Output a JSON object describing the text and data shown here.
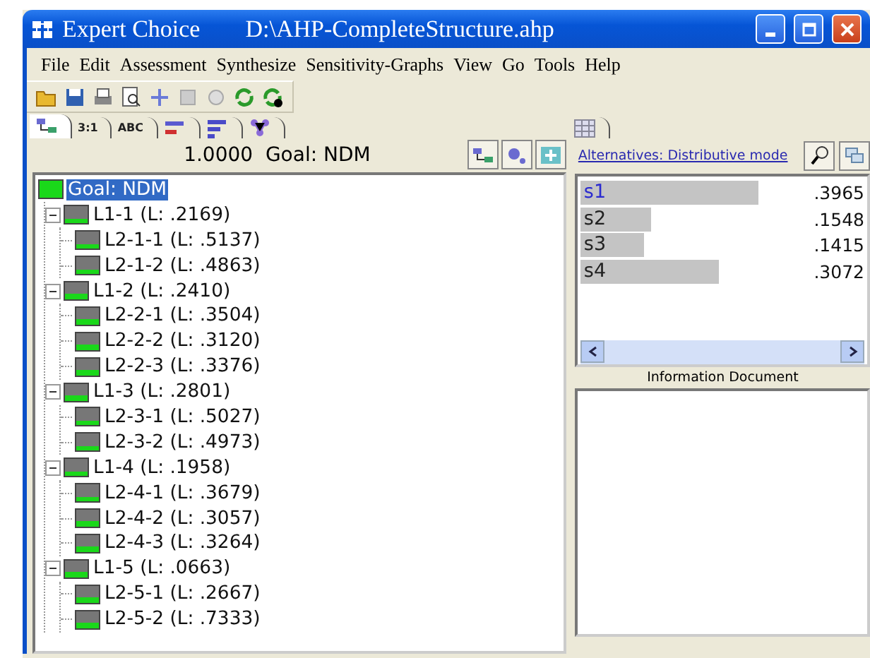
{
  "window": {
    "title": "Expert Choice",
    "file": "D:\\AHP-CompleteStructure.ahp"
  },
  "menu": [
    "File",
    "Edit",
    "Assessment",
    "Synthesize",
    "Sensitivity-Graphs",
    "View",
    "Go",
    "Tools",
    "Help"
  ],
  "view_tabs": [
    {
      "kind": "tree",
      "selected": true
    },
    {
      "kind": "text",
      "label": "3:1",
      "selected": false
    },
    {
      "kind": "text",
      "label": "ABC",
      "selected": false
    },
    {
      "kind": "bars-red",
      "selected": false
    },
    {
      "kind": "bars",
      "selected": false
    },
    {
      "kind": "sensitivity",
      "selected": false
    },
    {
      "kind": "grid",
      "selected": false
    }
  ],
  "goal_bar": {
    "priority": "1.0000",
    "label": "Goal: NDM"
  },
  "tree": {
    "label": "Goal: NDM",
    "selected": true,
    "children": [
      {
        "label": "L1-1 (L: .2169)",
        "selected": false,
        "expanded": true,
        "children": [
          {
            "label": "L2-1-1 (L: .5137)",
            "selected": false
          },
          {
            "label": "L2-1-2 (L: .4863)",
            "selected": false
          }
        ]
      },
      {
        "label": "L1-2 (L: .2410)",
        "selected": false,
        "expanded": true,
        "children": [
          {
            "label": "L2-2-1 (L: .3504)",
            "selected": false
          },
          {
            "label": "L2-2-2 (L: .3120)",
            "selected": false
          },
          {
            "label": "L2-2-3 (L: .3376)",
            "selected": false
          }
        ]
      },
      {
        "label": "L1-3 (L: .2801)",
        "selected": false,
        "expanded": true,
        "children": [
          {
            "label": "L2-3-1 (L: .5027)",
            "selected": false
          },
          {
            "label": "L2-3-2 (L: .4973)",
            "selected": false
          }
        ]
      },
      {
        "label": "L1-4 (L: .1958)",
        "selected": false,
        "expanded": true,
        "children": [
          {
            "label": "L2-4-1 (L: .3679)",
            "selected": false
          },
          {
            "label": "L2-4-2 (L: .3057)",
            "selected": false
          },
          {
            "label": "L2-4-3 (L: .3264)",
            "selected": false
          }
        ]
      },
      {
        "label": "L1-5 (L: .0663)",
        "selected": false,
        "expanded": true,
        "children": [
          {
            "label": "L2-5-1 (L: .2667)",
            "selected": false
          },
          {
            "label": "L2-5-2 (L: .7333)",
            "selected": false
          }
        ]
      }
    ]
  },
  "alternatives": {
    "title": "Alternatives: Distributive mode",
    "items": [
      {
        "name": "s1",
        "value": ".3965",
        "selected": true
      },
      {
        "name": "s2",
        "value": ".1548",
        "selected": false
      },
      {
        "name": "s3",
        "value": ".1415",
        "selected": false
      },
      {
        "name": "s4",
        "value": ".3072",
        "selected": false
      }
    ]
  },
  "info_document": {
    "title": "Information Document"
  }
}
